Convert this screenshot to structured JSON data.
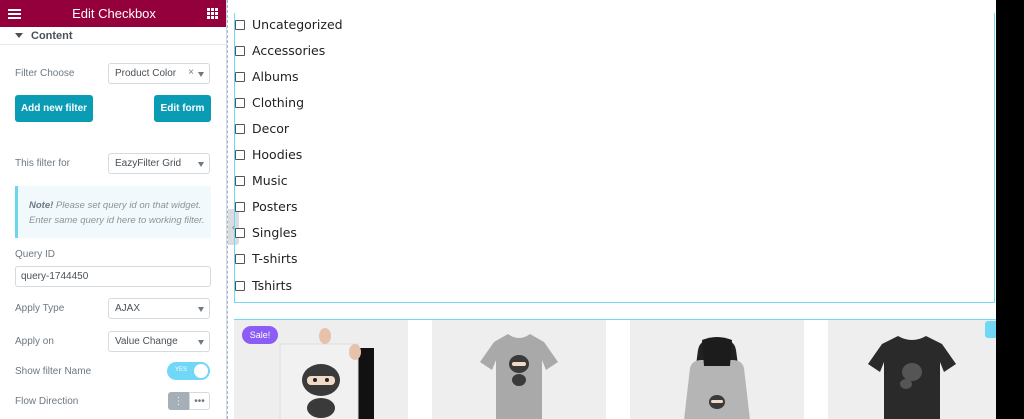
{
  "panel": {
    "title": "Edit Checkbox",
    "section": "Content",
    "filter_choose": {
      "label": "Filter Choose",
      "value": "Product Color",
      "clear": "×"
    },
    "buttons": {
      "add": "Add new filter",
      "edit": "Edit form"
    },
    "filter_for": {
      "label": "This filter for",
      "value": "EazyFilter Grid"
    },
    "note": {
      "bold": "Note!",
      "text": " Please set query id on that widget. Enter same query id here to working filter."
    },
    "query": {
      "label": "Query ID",
      "value": "query-1744450"
    },
    "apply_type": {
      "label": "Apply Type",
      "value": "AJAX"
    },
    "apply_on": {
      "label": "Apply on",
      "value": "Value Change"
    },
    "show_name": {
      "label": "Show filter Name",
      "toggle_text": "YES"
    },
    "flow": {
      "label": "Flow Direction",
      "opt1": "⋮",
      "opt2": "•••"
    },
    "collapse_glyph": "‹"
  },
  "categories": [
    "Uncategorized",
    "Accessories",
    "Albums",
    "Clothing",
    "Decor",
    "Hoodies",
    "Music",
    "Posters",
    "Singles",
    "T-shirts",
    "Tshirts"
  ],
  "products": {
    "sale_badge": "Sale!"
  },
  "colors": {
    "header": "#93003c",
    "accent": "#0a9bb5",
    "highlight": "#71d7f7",
    "sale": "#8b5cf6"
  }
}
